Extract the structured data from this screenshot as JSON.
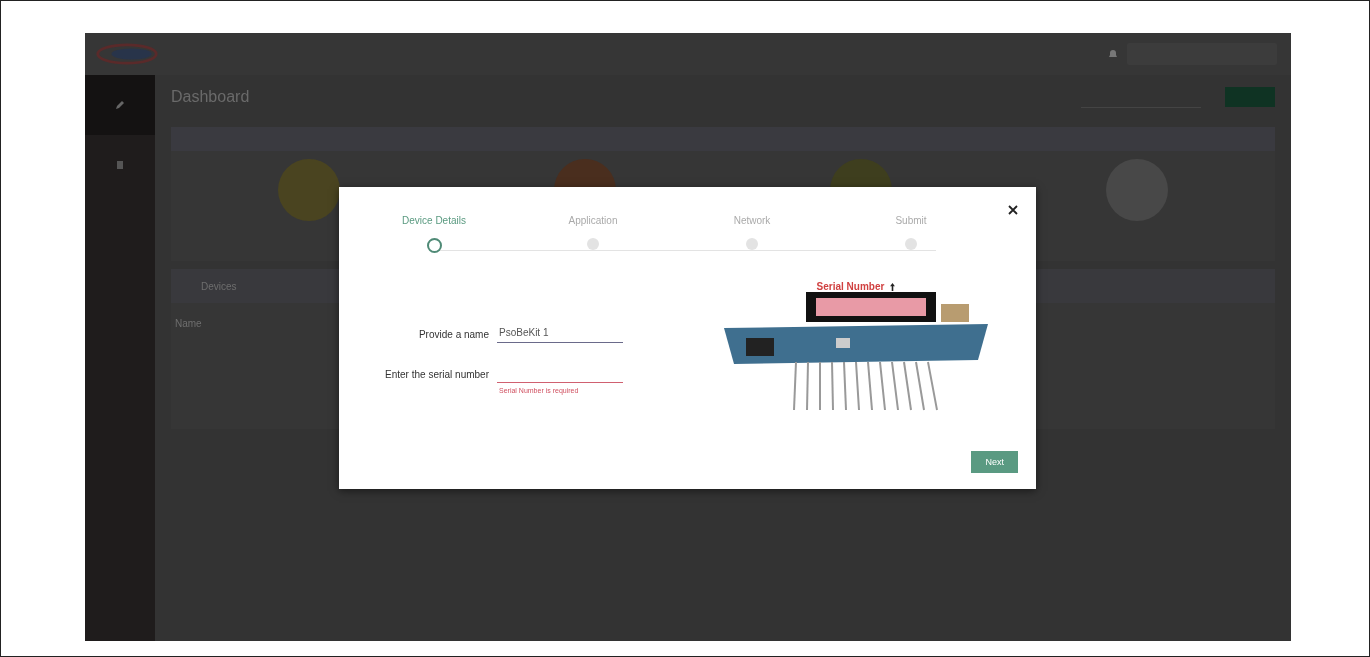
{
  "page": {
    "title": "Dashboard"
  },
  "sections": [
    {
      "title": "Devices",
      "columns": [
        "Name"
      ]
    }
  ],
  "dialog": {
    "steps": [
      {
        "label": "Device Details",
        "selected": true
      },
      {
        "label": "Application",
        "selected": false
      },
      {
        "label": "Network",
        "selected": false
      },
      {
        "label": "Submit",
        "selected": false
      }
    ],
    "fields": [
      {
        "label": "Provide a name",
        "value": "PsoBeKit 1",
        "error": false
      },
      {
        "label": "Enter the serial number",
        "error": true,
        "message": "Serial Number is required"
      }
    ],
    "image_caption": "Serial Number",
    "button": "Next"
  }
}
